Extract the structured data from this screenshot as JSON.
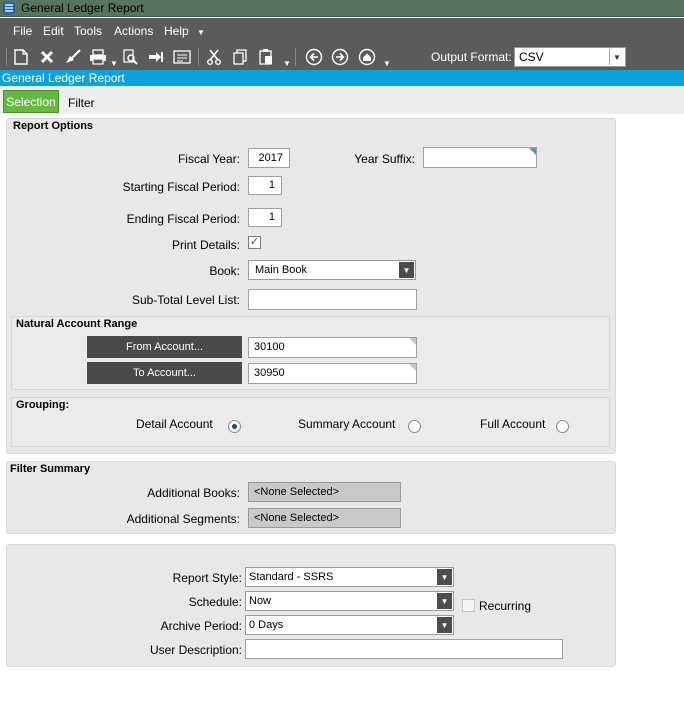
{
  "window": {
    "title": "General Ledger Report"
  },
  "menu": [
    "File",
    "Edit",
    "Tools",
    "Actions",
    "Help"
  ],
  "toolbar": {
    "output_format_label": "Output Format:",
    "output_format_value": "CSV",
    "icons": [
      "new-icon",
      "delete-icon",
      "clear-icon",
      "print-icon",
      "print-preview-icon",
      "submit-icon",
      "generate-icon",
      "cut-icon",
      "copy-icon",
      "paste-icon",
      "back-icon",
      "forward-icon",
      "home-icon"
    ]
  },
  "header": {
    "title": "General Ledger Report"
  },
  "tabs": [
    "Selection",
    "Filter"
  ],
  "report_options": {
    "title": "Report Options",
    "fiscal_year_label": "Fiscal Year:",
    "fiscal_year": "2017",
    "year_suffix_label": "Year Suffix:",
    "year_suffix": "",
    "start_period_label": "Starting Fiscal Period:",
    "start_period": "1",
    "end_period_label": "Ending Fiscal Period:",
    "end_period": "1",
    "print_details_label": "Print Details:",
    "print_details_mark": "✓",
    "book_label": "Book:",
    "book": "Main Book",
    "subtotal_label": "Sub-Total Level List:",
    "subtotal": ""
  },
  "natural_account_range": {
    "title": "Natural Account Range",
    "from_button": "From Account...",
    "from_value": "30100",
    "to_button": "To Account...",
    "to_value": "30950"
  },
  "grouping": {
    "title": "Grouping:",
    "options": [
      "Detail Account",
      "Summary Account",
      "Full Account"
    ],
    "selected": "Detail Account"
  },
  "filter_summary": {
    "title": "Filter Summary",
    "books_label": "Additional Books:",
    "books_value": "<None Selected>",
    "segments_label": "Additional Segments:",
    "segments_value": "<None Selected>"
  },
  "schedule": {
    "style_label": "Report Style:",
    "style_value": "Standard - SSRS",
    "schedule_label": "Schedule:",
    "schedule_value": "Now",
    "recurring_label": "Recurring",
    "archive_label": "Archive Period:",
    "archive_value": "0 Days",
    "description_label": "User Description:",
    "description_value": ""
  },
  "colors": {
    "accent_blue": "#0aa3de",
    "tab_green": "#66b93f",
    "chrome_dark": "#5b5b5b",
    "title_green": "#56745e"
  }
}
